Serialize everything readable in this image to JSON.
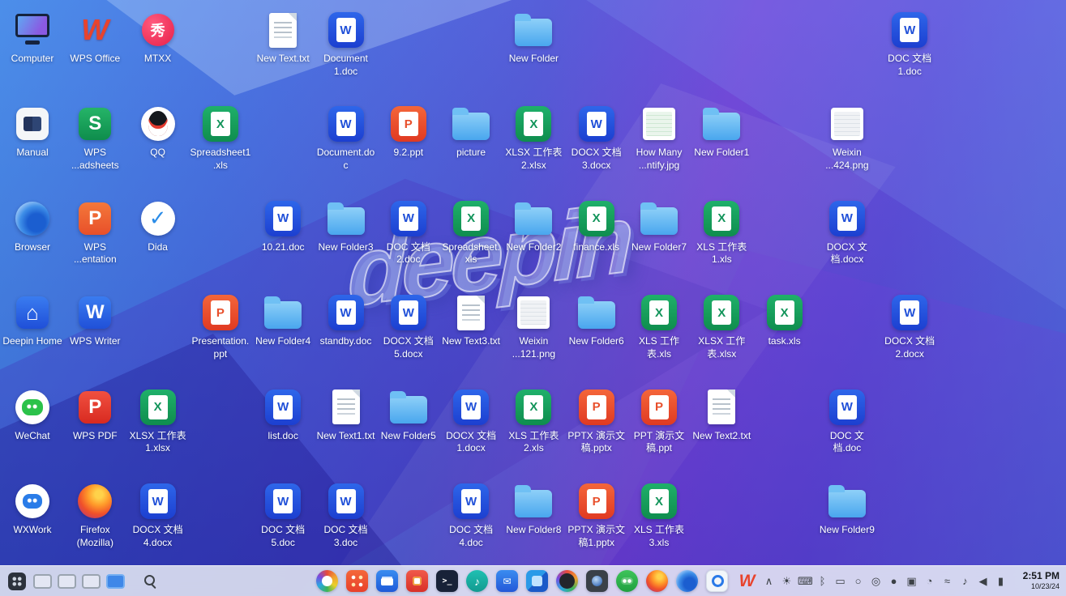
{
  "desktop": {
    "watermark": "deepin",
    "accent_color": "#3f87e8",
    "icons": [
      {
        "col": 1,
        "row": 1,
        "label": "Computer",
        "kind": "app",
        "art": "computer"
      },
      {
        "col": 2,
        "row": 1,
        "label": "WPS Office",
        "kind": "app",
        "art": "wps-office",
        "glyph": "W"
      },
      {
        "col": 3,
        "row": 1,
        "label": "MTXX",
        "kind": "app",
        "art": "mtxx",
        "glyph": "秀"
      },
      {
        "col": 5,
        "row": 1,
        "label": "New Text.txt",
        "kind": "txt"
      },
      {
        "col": 6,
        "row": 1,
        "label": "Document 1.doc",
        "kind": "doc"
      },
      {
        "col": 9,
        "row": 1,
        "label": "New Folder",
        "kind": "folder"
      },
      {
        "col": 15,
        "row": 1,
        "label": "DOC 文档 1.doc",
        "kind": "doc"
      },
      {
        "col": 1,
        "row": 2,
        "label": "Manual",
        "kind": "app",
        "art": "manual"
      },
      {
        "col": 2,
        "row": 2,
        "label": "WPS ...adsheets",
        "kind": "app",
        "art": "wps-spreadsheets",
        "glyph": "S"
      },
      {
        "col": 3,
        "row": 2,
        "label": "QQ",
        "kind": "app",
        "art": "qq"
      },
      {
        "col": 4,
        "row": 2,
        "label": "Spreadsheet1.xls",
        "kind": "xls"
      },
      {
        "col": 6,
        "row": 2,
        "label": "Document.doc",
        "kind": "doc"
      },
      {
        "col": 7,
        "row": 2,
        "label": "9.2.ppt",
        "kind": "ppt"
      },
      {
        "col": 8,
        "row": 2,
        "label": "picture",
        "kind": "folder"
      },
      {
        "col": 9,
        "row": 2,
        "label": "XLSX 工作表2.xlsx",
        "kind": "xls"
      },
      {
        "col": 10,
        "row": 2,
        "label": "DOCX 文档 3.docx",
        "kind": "doc"
      },
      {
        "col": 11,
        "row": 2,
        "label": "How Many ...ntify.jpg",
        "kind": "image",
        "thumb": "sheet"
      },
      {
        "col": 12,
        "row": 2,
        "label": "New Folder1",
        "kind": "folder"
      },
      {
        "col": 14,
        "row": 2,
        "label": "Weixin ...424.png",
        "kind": "image",
        "thumb": "gray"
      },
      {
        "col": 1,
        "row": 3,
        "label": "Browser",
        "kind": "app",
        "art": "browser"
      },
      {
        "col": 2,
        "row": 3,
        "label": "WPS ...entation",
        "kind": "app",
        "art": "wps-presentation",
        "glyph": "P"
      },
      {
        "col": 3,
        "row": 3,
        "label": "Dida",
        "kind": "app",
        "art": "dida",
        "glyph": "✓"
      },
      {
        "col": 5,
        "row": 3,
        "label": "10.21.doc",
        "kind": "doc"
      },
      {
        "col": 6,
        "row": 3,
        "label": "New Folder3",
        "kind": "folder"
      },
      {
        "col": 7,
        "row": 3,
        "label": "DOC 文档 2.doc",
        "kind": "doc"
      },
      {
        "col": 8,
        "row": 3,
        "label": "Spreadsheet.xls",
        "kind": "xls"
      },
      {
        "col": 9,
        "row": 3,
        "label": "New Folder2",
        "kind": "folder"
      },
      {
        "col": 10,
        "row": 3,
        "label": "finance.xls",
        "kind": "xls"
      },
      {
        "col": 11,
        "row": 3,
        "label": "New Folder7",
        "kind": "folder"
      },
      {
        "col": 12,
        "row": 3,
        "label": "XLS 工作表 1.xls",
        "kind": "xls"
      },
      {
        "col": 14,
        "row": 3,
        "label": "DOCX 文档.docx",
        "kind": "doc"
      },
      {
        "col": 1,
        "row": 4,
        "label": "Deepin Home",
        "kind": "app",
        "art": "deepin-home",
        "glyph": "⌂"
      },
      {
        "col": 2,
        "row": 4,
        "label": "WPS Writer",
        "kind": "app",
        "art": "wps-writer",
        "glyph": "W"
      },
      {
        "col": 4,
        "row": 4,
        "label": "Presentation.ppt",
        "kind": "ppt"
      },
      {
        "col": 5,
        "row": 4,
        "label": "New Folder4",
        "kind": "folder"
      },
      {
        "col": 6,
        "row": 4,
        "label": "standby.doc",
        "kind": "doc"
      },
      {
        "col": 7,
        "row": 4,
        "label": "DOCX 文档 5.docx",
        "kind": "doc"
      },
      {
        "col": 8,
        "row": 4,
        "label": "New Text3.txt",
        "kind": "txt"
      },
      {
        "col": 9,
        "row": 4,
        "label": "Weixin ...121.png",
        "kind": "image",
        "thumb": "gray"
      },
      {
        "col": 10,
        "row": 4,
        "label": "New Folder6",
        "kind": "folder"
      },
      {
        "col": 11,
        "row": 4,
        "label": "XLS 工作表.xls",
        "kind": "xls"
      },
      {
        "col": 12,
        "row": 4,
        "label": "XLSX 工作表.xlsx",
        "kind": "xls"
      },
      {
        "col": 13,
        "row": 4,
        "label": "task.xls",
        "kind": "xls"
      },
      {
        "col": 15,
        "row": 4,
        "label": "DOCX 文档 2.docx",
        "kind": "doc"
      },
      {
        "col": 1,
        "row": 5,
        "label": "WeChat",
        "kind": "app",
        "art": "wechat"
      },
      {
        "col": 2,
        "row": 5,
        "label": "WPS PDF",
        "kind": "app",
        "art": "wps-pdf",
        "glyph": "P"
      },
      {
        "col": 3,
        "row": 5,
        "label": "XLSX 工作表1.xlsx",
        "kind": "xls"
      },
      {
        "col": 5,
        "row": 5,
        "label": "list.doc",
        "kind": "doc"
      },
      {
        "col": 6,
        "row": 5,
        "label": "New Text1.txt",
        "kind": "txt"
      },
      {
        "col": 7,
        "row": 5,
        "label": "New Folder5",
        "kind": "folder"
      },
      {
        "col": 8,
        "row": 5,
        "label": "DOCX 文档 1.docx",
        "kind": "doc"
      },
      {
        "col": 9,
        "row": 5,
        "label": "XLS 工作表 2.xls",
        "kind": "xls"
      },
      {
        "col": 10,
        "row": 5,
        "label": "PPTX 演示文稿.pptx",
        "kind": "ppt"
      },
      {
        "col": 11,
        "row": 5,
        "label": "PPT 演示文稿.ppt",
        "kind": "ppt"
      },
      {
        "col": 12,
        "row": 5,
        "label": "New Text2.txt",
        "kind": "txt"
      },
      {
        "col": 14,
        "row": 5,
        "label": "DOC 文档.doc",
        "kind": "doc"
      },
      {
        "col": 1,
        "row": 6,
        "label": "WXWork",
        "kind": "app",
        "art": "wxwork"
      },
      {
        "col": 2,
        "row": 6,
        "label": "Firefox (Mozilla)",
        "kind": "app",
        "art": "firefox"
      },
      {
        "col": 3,
        "row": 6,
        "label": "DOCX 文档 4.docx",
        "kind": "doc"
      },
      {
        "col": 5,
        "row": 6,
        "label": "DOC 文档 5.doc",
        "kind": "doc"
      },
      {
        "col": 6,
        "row": 6,
        "label": "DOC 文档 3.doc",
        "kind": "doc"
      },
      {
        "col": 8,
        "row": 6,
        "label": "DOC 文档 4.doc",
        "kind": "doc"
      },
      {
        "col": 9,
        "row": 6,
        "label": "New Folder8",
        "kind": "folder"
      },
      {
        "col": 10,
        "row": 6,
        "label": "PPTX 演示文稿1.pptx",
        "kind": "ppt"
      },
      {
        "col": 11,
        "row": 6,
        "label": "XLS 工作表 3.xls",
        "kind": "xls"
      },
      {
        "col": 14,
        "row": 6,
        "label": "New Folder9",
        "kind": "folder"
      }
    ],
    "file_badges": {
      "doc": "W",
      "xls": "X",
      "ppt": "P"
    }
  },
  "taskbar": {
    "left": {
      "window_previews": 4,
      "active_preview": 4
    },
    "dock": [
      {
        "name": "launcher",
        "style": "launcher"
      },
      {
        "name": "app-store",
        "style": "store"
      },
      {
        "name": "file-manager",
        "style": "files"
      },
      {
        "name": "app-market",
        "style": "market"
      },
      {
        "name": "terminal",
        "style": "terminal",
        "glyph": ">_"
      },
      {
        "name": "music",
        "style": "music",
        "glyph": "♪"
      },
      {
        "name": "mail",
        "style": "mail",
        "glyph": "✉"
      },
      {
        "name": "text-editor",
        "style": "editor"
      },
      {
        "name": "control-center",
        "style": "control"
      },
      {
        "name": "camera",
        "style": "camera"
      },
      {
        "name": "voice-assistant",
        "style": "assistant"
      },
      {
        "name": "firefox",
        "style": "firefox"
      },
      {
        "name": "browser",
        "style": "browser"
      },
      {
        "name": "screen-capture",
        "style": "capture"
      },
      {
        "name": "wps-office",
        "style": "wps",
        "glyph": "W"
      }
    ],
    "tray": [
      {
        "name": "expand-chevron",
        "glyph": "∧"
      },
      {
        "name": "brightness",
        "glyph": "☀"
      },
      {
        "name": "keyboard",
        "glyph": "⌨"
      },
      {
        "name": "bluetooth",
        "glyph": "ᛒ"
      },
      {
        "name": "display",
        "glyph": "▭"
      },
      {
        "name": "power-manager",
        "glyph": "○"
      },
      {
        "name": "eye-comfort",
        "glyph": "◎"
      },
      {
        "name": "screen-record",
        "glyph": "●"
      },
      {
        "name": "workspace",
        "glyph": "▣"
      },
      {
        "name": "notifications",
        "glyph": "◔"
      },
      {
        "name": "network",
        "glyph": "≈"
      },
      {
        "name": "headset",
        "glyph": "♪"
      },
      {
        "name": "volume",
        "glyph": "◀"
      },
      {
        "name": "battery",
        "glyph": "▮"
      }
    ],
    "clock": {
      "time": "2:51 PM",
      "date": "10/23/24"
    }
  }
}
